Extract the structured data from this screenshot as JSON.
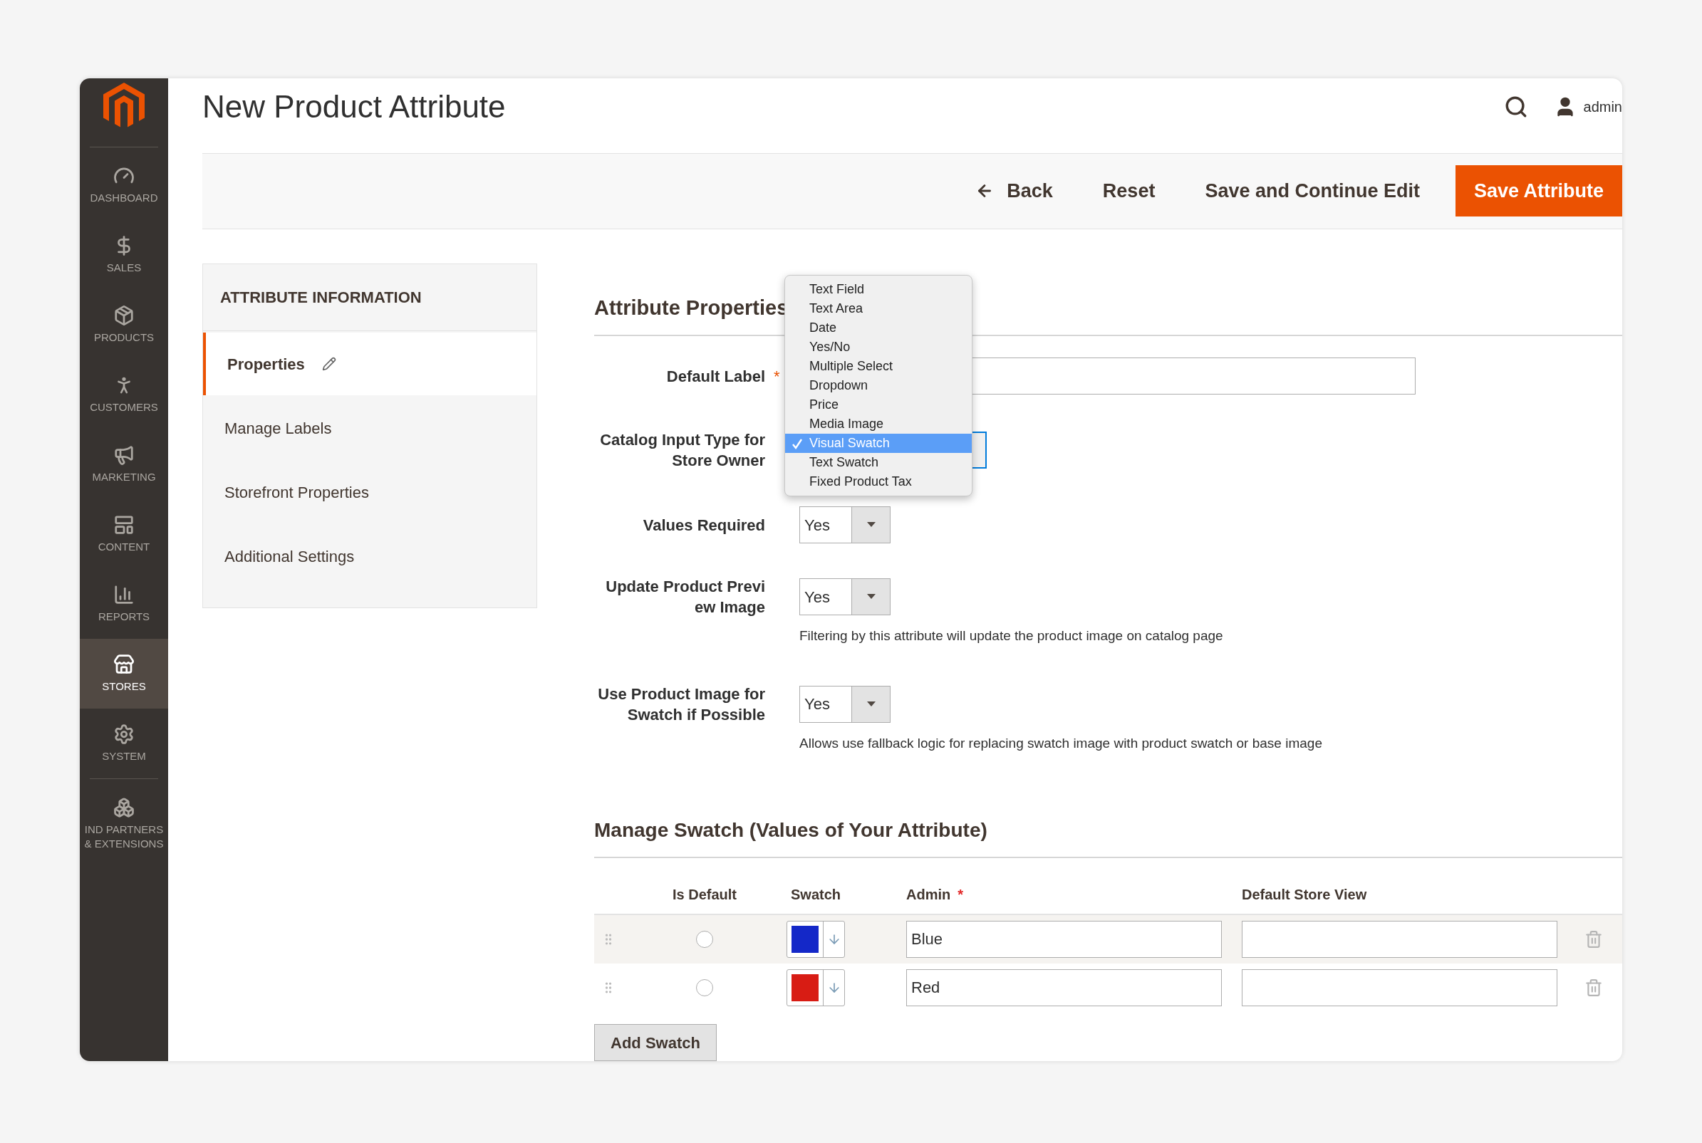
{
  "sidebar": {
    "items": [
      {
        "kind": "dashboard",
        "label": "DASHBOARD",
        "selected": false
      },
      {
        "kind": "sales",
        "label": "SALES",
        "selected": false
      },
      {
        "kind": "products",
        "label": "PRODUCTS",
        "selected": false
      },
      {
        "kind": "customers",
        "label": "CUSTOMERS",
        "selected": false
      },
      {
        "kind": "marketing",
        "label": "MARKETING",
        "selected": false
      },
      {
        "kind": "content",
        "label": "CONTENT",
        "selected": false
      },
      {
        "kind": "reports",
        "label": "REPORTS",
        "selected": false
      },
      {
        "kind": "stores",
        "label": "STORES",
        "selected": true
      },
      {
        "kind": "system",
        "label": "SYSTEM",
        "selected": false
      },
      {
        "kind": "partners",
        "label": "IND PARTNERS & EXTENSIONS",
        "selected": false
      }
    ]
  },
  "header": {
    "title": "New Product Attribute",
    "user": "admin"
  },
  "actions": {
    "back": "Back",
    "reset": "Reset",
    "save_continue": "Save and Continue Edit",
    "save": "Save Attribute"
  },
  "left_panel": {
    "heading": "ATTRIBUTE INFORMATION",
    "tabs": [
      {
        "label": "Properties",
        "selected": true,
        "editable": true
      },
      {
        "label": "Manage Labels",
        "selected": false,
        "editable": false
      },
      {
        "label": "Storefront Properties",
        "selected": false,
        "editable": false
      },
      {
        "label": "Additional Settings",
        "selected": false,
        "editable": false
      }
    ]
  },
  "properties": {
    "heading": "Attribute Properties",
    "default_label": {
      "label": "Default Label",
      "required_mark": "*"
    },
    "input_type": {
      "label": "Catalog Input Type for Store Owner",
      "options": [
        {
          "label": "Text Field",
          "selected": false
        },
        {
          "label": "Text Area",
          "selected": false
        },
        {
          "label": "Date",
          "selected": false
        },
        {
          "label": "Yes/No",
          "selected": false
        },
        {
          "label": "Multiple Select",
          "selected": false
        },
        {
          "label": "Dropdown",
          "selected": false
        },
        {
          "label": "Price",
          "selected": false
        },
        {
          "label": "Media Image",
          "selected": false
        },
        {
          "label": "Visual Swatch",
          "selected": true
        },
        {
          "label": "Text Swatch",
          "selected": false
        },
        {
          "label": "Fixed Product Tax",
          "selected": false
        }
      ]
    },
    "selects": [
      {
        "label": "Values Required",
        "value": "Yes"
      },
      {
        "label": "Update Product Previ ew Image",
        "value": "Yes",
        "note": "Filtering by this attribute will update the product image on catalog page"
      },
      {
        "label": "Use Product Image for Swatch if Possible",
        "value": "Yes",
        "note": "Allows use fallback logic for replacing swatch image with product swatch or base image"
      }
    ]
  },
  "swatches": {
    "heading": "Manage Swatch (Values of Your Attribute)",
    "columns": [
      "Is Default",
      "Swatch",
      "Admin",
      "Default Store View"
    ],
    "admin_required_mark": "*",
    "rows": [
      {
        "is_default": false,
        "color": "#1428c8",
        "admin": "Blue",
        "highlighted": true
      },
      {
        "is_default": false,
        "color": "#d81c14",
        "admin": "Red",
        "highlighted": false
      }
    ],
    "add_button": "Add Swatch"
  }
}
